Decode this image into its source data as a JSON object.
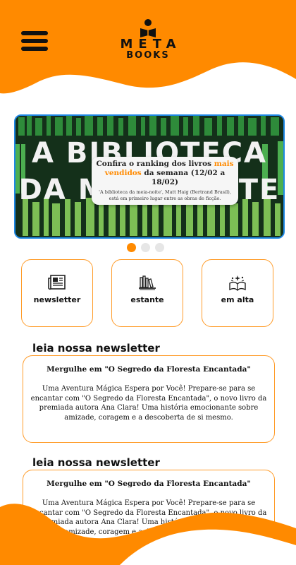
{
  "header": {
    "brand": "META",
    "brand_sub": "BOOKS",
    "menu_icon": "hamburger-menu-icon",
    "logo_icon": "reader-icon",
    "accent_color": "#ff8a00"
  },
  "banner": {
    "background_title_line1": "A BIBLIOTECA",
    "background_title_line2": "DA MEIA-NOITE",
    "card_title_before": "Confira o ranking dos livros ",
    "card_title_highlight": "mais vendidos",
    "card_title_after": " da semana (12/02 a 18/02)",
    "card_subtitle": "'A biblioteca da meia-noite', Matt Haig (Bertrand Brasil), está em primeiro lugar entre as obras de ficção."
  },
  "carousel": {
    "dots": 3,
    "active_index": 0
  },
  "tiles": [
    {
      "label": "newsletter",
      "icon": "newspaper-icon"
    },
    {
      "label": "estante",
      "icon": "bookshelf-icon"
    },
    {
      "label": "em alta",
      "icon": "open-book-sparkle-icon"
    }
  ],
  "sections": [
    {
      "title": "leia nossa newsletter",
      "heading": "Mergulhe em \"O Segredo da Floresta Encantada\"",
      "body": "Uma Aventura Mágica Espera por Você! Prepare-se para se encantar com \"O Segredo da Floresta Encantada\", o novo livro da premiada autora Ana Clara! Uma história emocionante sobre amizade, coragem e a descoberta de si mesmo."
    },
    {
      "title": "leia nossa newsletter",
      "heading": "Mergulhe em \"O Segredo da Floresta Encantada\"",
      "body": "Uma Aventura Mágica Espera por Você! Prepare-se para se encantar com \"O Segredo da Floresta Encantada\", o novo livro da premiada autora Ana Clara! Uma história emocionante sobre amizade, coragem e a descoberta de si mesmo."
    }
  ]
}
